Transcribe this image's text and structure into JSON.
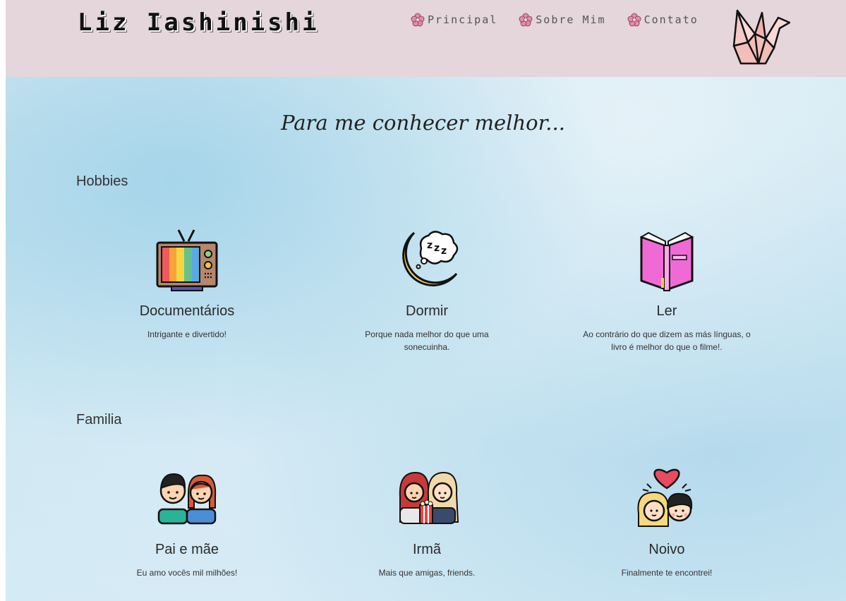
{
  "header": {
    "title": "Liz Iashinishi",
    "nav": [
      {
        "label": "Principal",
        "icon": "flower-icon"
      },
      {
        "label": "Sobre Mim",
        "icon": "flower-icon"
      },
      {
        "label": "Contato",
        "icon": "flower-icon"
      }
    ],
    "logo_icon": "origami-crane-icon"
  },
  "main": {
    "heading": "Para me conhecer melhor...",
    "groups": [
      {
        "title": "Hobbies",
        "cards": [
          {
            "title": "Documentários",
            "description": "Intrigante e divertido!",
            "icon": "tv-icon"
          },
          {
            "title": "Dormir",
            "description": "Porque nada melhor do que uma sonecuinha.",
            "icon": "sleeping-moon-icon"
          },
          {
            "title": "Ler",
            "description": "Ao contrário do que dizem as más línguas, o livro é melhor do que o filme!.",
            "icon": "book-icon"
          }
        ]
      },
      {
        "title": "Familia",
        "cards": [
          {
            "title": "Pai e mãe",
            "description": "Eu amo vocês mil milhões!",
            "icon": "parents-icon"
          },
          {
            "title": "Irmã",
            "description": "Mais que amigas, friends.",
            "icon": "sisters-icon"
          },
          {
            "title": "Noivo",
            "description": "Finalmente te encontrei!",
            "icon": "couple-heart-icon"
          }
        ]
      }
    ]
  },
  "colors": {
    "header_bg": "#e4d6da",
    "page_bg": "#c5e3f0",
    "flower": "#e58aa8"
  }
}
